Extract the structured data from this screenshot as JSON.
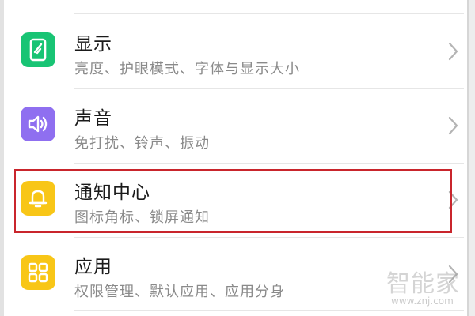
{
  "settings": {
    "items": [
      {
        "title": "显示",
        "subtitle": "亮度、护眼模式、字体与显示大小",
        "icon": "display-icon",
        "color": "#18c474"
      },
      {
        "title": "声音",
        "subtitle": "免打扰、铃声、振动",
        "icon": "speaker-icon",
        "color": "#8f6ff0"
      },
      {
        "title": "通知中心",
        "subtitle": "图标角标、锁屏通知",
        "icon": "bell-icon",
        "color": "#f8c617",
        "highlighted": true
      },
      {
        "title": "应用",
        "subtitle": "权限管理、默认应用、应用分身",
        "icon": "apps-grid-icon",
        "color": "#f8c617"
      }
    ]
  },
  "watermark": {
    "title": "智能家",
    "url": "www.znj.com"
  },
  "colors": {
    "highlight_border": "#c9252c"
  }
}
